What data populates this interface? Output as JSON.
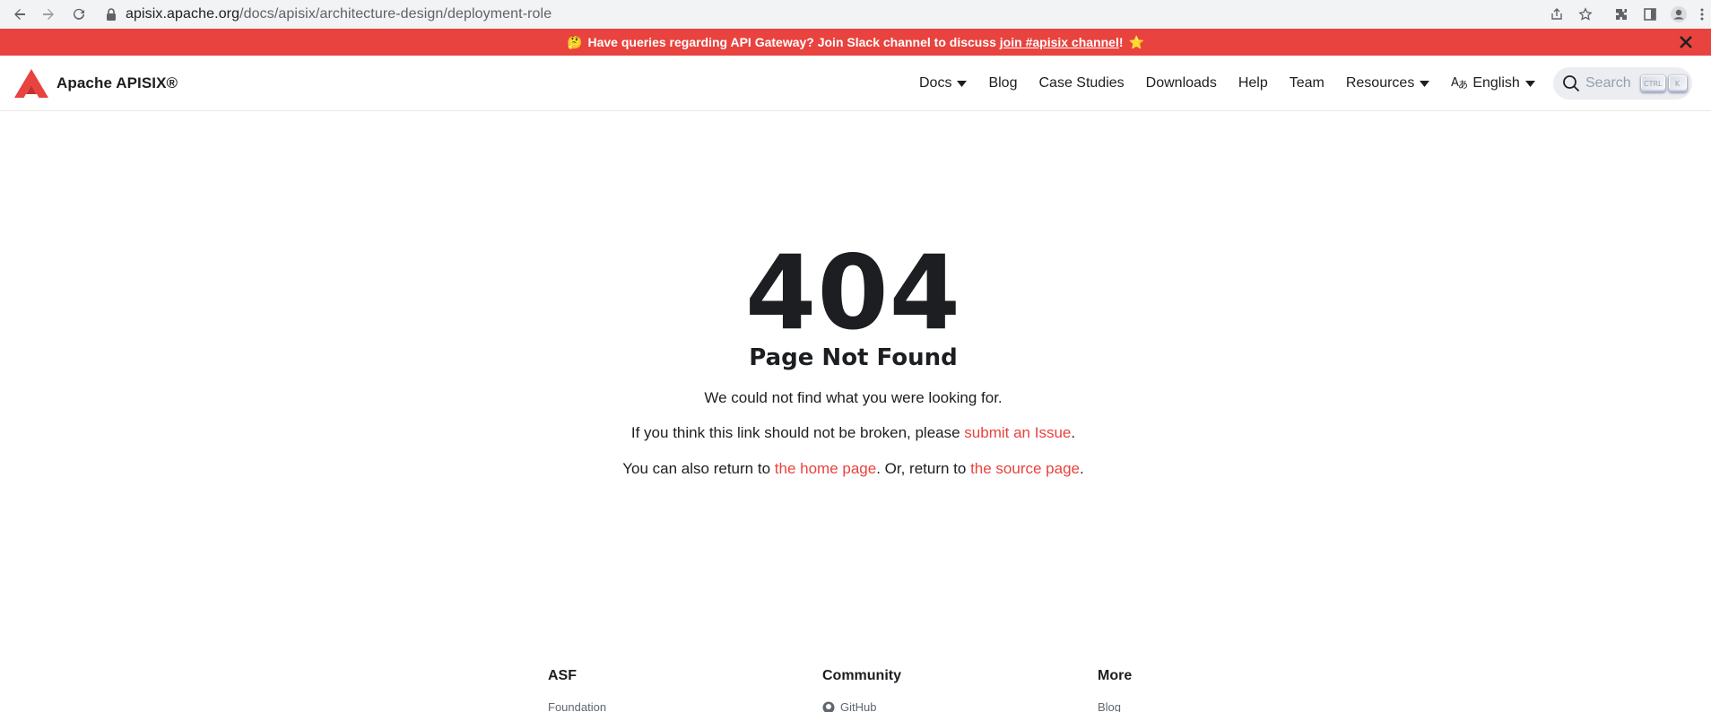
{
  "browser": {
    "url_host": "apisix.apache.org",
    "url_path": "/docs/apisix/architecture-design/deployment-role",
    "icons": [
      "back-arrow-icon",
      "forward-arrow-icon",
      "reload-icon",
      "lock-icon",
      "share-icon",
      "star-icon",
      "extensions-icon",
      "side-panel-icon",
      "profile-icon",
      "kebab-menu-icon"
    ]
  },
  "announcement": {
    "emoji": "🤔",
    "text": "Have queries regarding API Gateway? Join Slack channel to discuss",
    "link": "join #apisix channel",
    "suffix": "!",
    "star": "⭐",
    "background": "#e8433e"
  },
  "navbar": {
    "brand": "Apache APISIX®",
    "links": {
      "docs": "Docs",
      "blog": "Blog",
      "case_studies": "Case Studies",
      "downloads": "Downloads",
      "help": "Help",
      "team": "Team",
      "resources": "Resources",
      "language": "English"
    },
    "search": {
      "placeholder": "Search",
      "key_ctrl": "CTRL",
      "key_k": "K"
    }
  },
  "not_found": {
    "code": "404",
    "title": "Page Not Found",
    "line1": "We could not find what you were looking for.",
    "line2_prefix": "If you think this link should not be broken, please ",
    "line2_link": "submit an Issue",
    "line2_suffix": ".",
    "line3_prefix": "You can also return to ",
    "line3_link1": "the home page",
    "line3_middle": ". Or, return to ",
    "line3_link2": "the source page",
    "line3_suffix": ".",
    "link_color": "#e8433e"
  },
  "footer": {
    "columns": [
      {
        "title": "ASF",
        "first_item": "Foundation"
      },
      {
        "title": "Community",
        "first_item": "GitHub"
      },
      {
        "title": "More",
        "first_item": "Blog"
      }
    ]
  }
}
